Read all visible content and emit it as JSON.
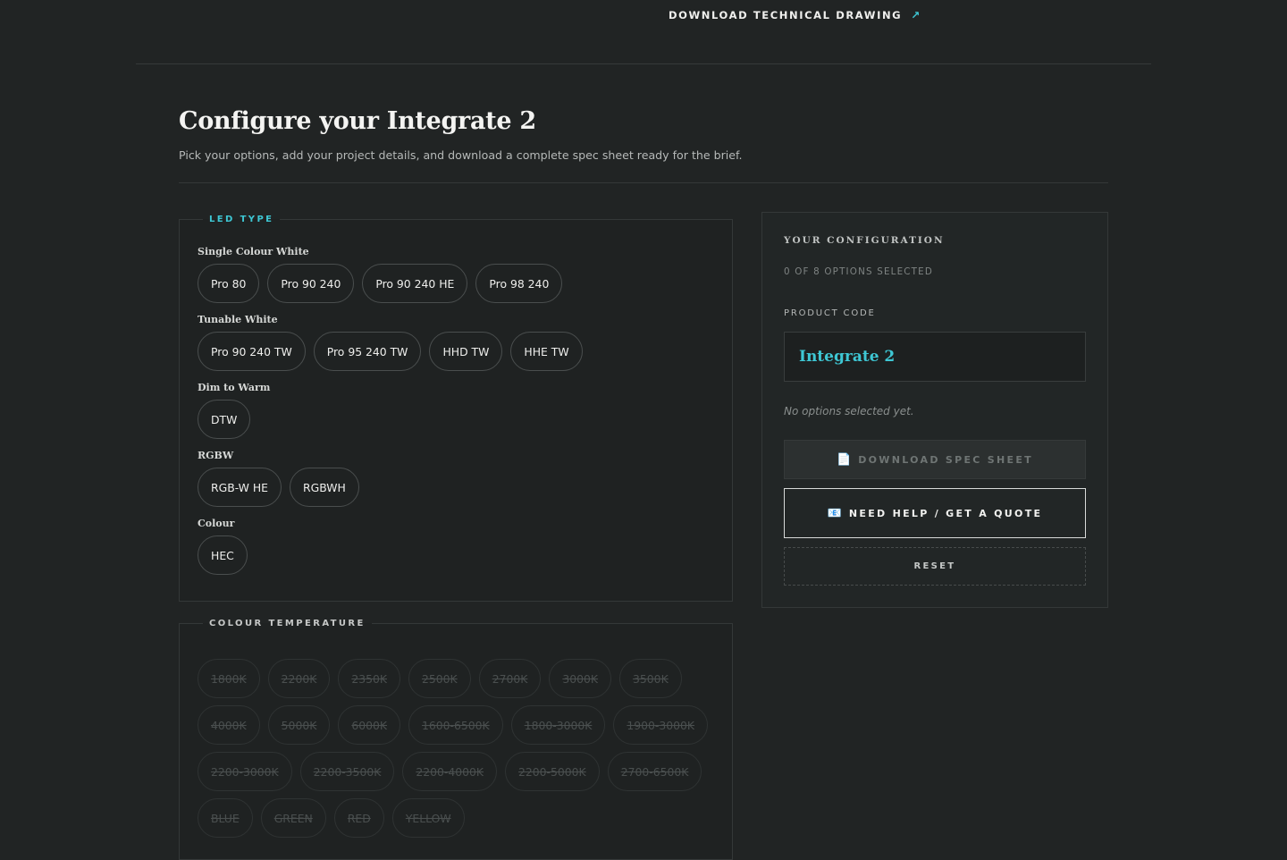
{
  "top": {
    "download_drawing_label": "DOWNLOAD TECHNICAL DRAWING",
    "download_icon": "arrow-up-right-icon"
  },
  "header": {
    "title": "Configure your Integrate 2",
    "subtitle": "Pick your options, add your project details, and download a complete spec sheet ready for the brief."
  },
  "led_type": {
    "legend": "LED TYPE",
    "groups": [
      {
        "label": "Single Colour White",
        "options": [
          "Pro 80",
          "Pro 90 240",
          "Pro 90 240 HE",
          "Pro 98 240"
        ]
      },
      {
        "label": "Tunable White",
        "options": [
          "Pro 90 240 TW",
          "Pro 95 240 TW",
          "HHD TW",
          "HHE TW"
        ]
      },
      {
        "label": "Dim to Warm",
        "options": [
          "DTW"
        ]
      },
      {
        "label": "RGBW",
        "options": [
          "RGB-W HE",
          "RGBWH"
        ]
      },
      {
        "label": "Colour",
        "options": [
          "HEC"
        ]
      }
    ]
  },
  "colour_temperature": {
    "legend": "COLOUR TEMPERATURE",
    "rows": [
      [
        "1800K",
        "2200K",
        "2350K",
        "2500K",
        "2700K",
        "3000K",
        "3500K"
      ],
      [
        "4000K",
        "5000K",
        "6000K",
        "1600-6500K",
        "1800-3000K",
        "1900-3000K"
      ],
      [
        "2200-3000K",
        "2200-3500K",
        "2200-4000K",
        "2200-5000K",
        "2700-6500K"
      ],
      [
        "BLUE",
        "GREEN",
        "RED",
        "YELLOW"
      ]
    ]
  },
  "config": {
    "title": "YOUR CONFIGURATION",
    "count": "0 OF 8 OPTIONS SELECTED",
    "code_label": "PRODUCT CODE",
    "code_value": "Integrate 2",
    "empty_text": "No options selected yet.",
    "download_label": "DOWNLOAD SPEC SHEET",
    "download_icon": "document-icon",
    "quote_label": "NEED HELP / GET A QUOTE",
    "quote_icon": "envelope-icon",
    "reset_label": "RESET"
  },
  "colors": {
    "accent": "#3ec7d4",
    "background": "#212424"
  }
}
